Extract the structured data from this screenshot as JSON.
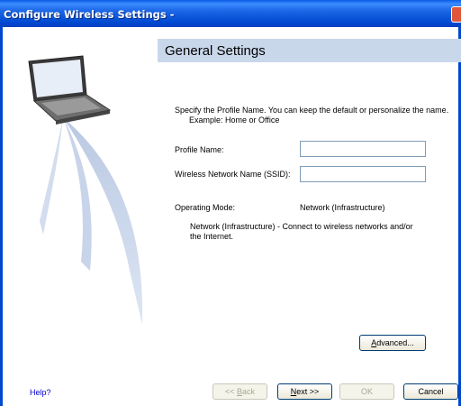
{
  "window": {
    "title": "Configure Wireless Settings -"
  },
  "header": {
    "title": "General Settings"
  },
  "intro": {
    "line1": "Specify the Profile Name. You can keep the default or personalize the name.",
    "line2": "Example: Home or Office"
  },
  "fields": {
    "profile_name_label": "Profile Name:",
    "profile_name_value": "",
    "ssid_label": "Wireless Network Name (SSID):",
    "ssid_value": ""
  },
  "mode": {
    "label": "Operating Mode:",
    "value": "Network (Infrastructure)",
    "desc_line1": "Network (Infrastructure) - Connect to wireless networks and/or",
    "desc_line2": "the Internet."
  },
  "buttons": {
    "advanced_prefix": "",
    "advanced_accel": "A",
    "advanced_rest": "dvanced...",
    "back_prefix": "<< ",
    "back_accel": "B",
    "back_rest": "ack",
    "next_accel": "N",
    "next_rest": "ext >>",
    "ok": "OK",
    "cancel": "Cancel"
  },
  "footer": {
    "help": "Help?"
  },
  "icons": {
    "close": "close-icon",
    "illustration": "laptop-wireless-illustration"
  },
  "colors": {
    "titlebar": "#0048d0",
    "header_band": "#c9d7ea",
    "help_link": "#0000cc"
  }
}
